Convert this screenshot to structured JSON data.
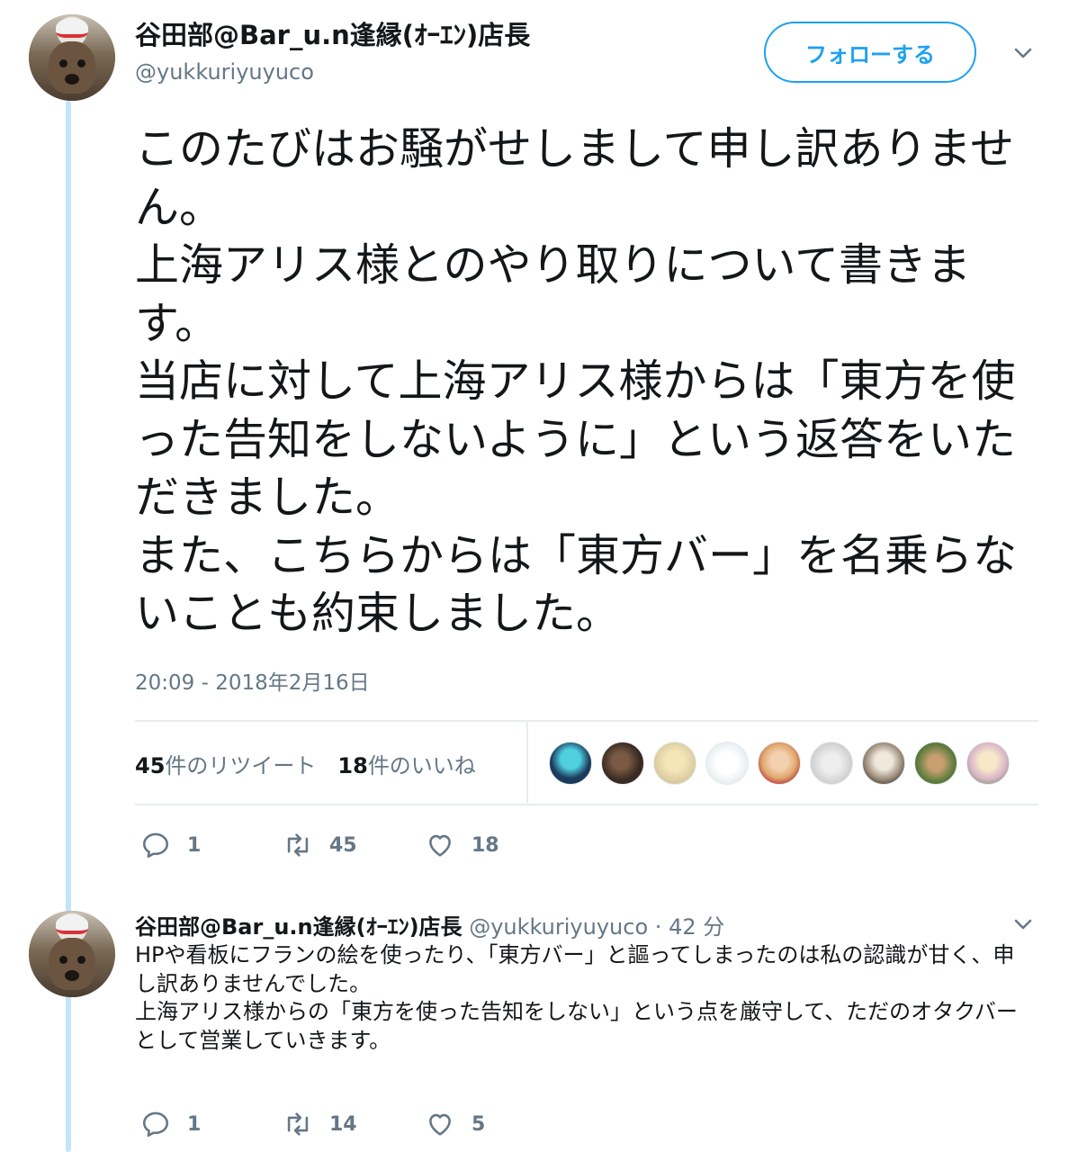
{
  "tweet": {
    "display_name": "谷田部@Bar_u.n逢縁(ｵｰｴﾝ)店長",
    "handle": "@yukkuriyuyuco",
    "follow_label": "フォローする",
    "text": "このたびはお騒がせしまして申し訳ありません。\n上海アリス様とのやり取りについて書きます。\n当店に対して上海アリス様からは「東方を使った告知をしないように」という返答をいただきました。\nまた、こちらからは「東方バー」を名乗らないことも約束しました。",
    "timestamp": "20:09 - 2018年2月16日",
    "retweet_count": "45",
    "retweet_label": "件のリツイート",
    "like_count": "18",
    "like_label": "件のいいね",
    "actions": {
      "reply": "1",
      "retweet": "45",
      "like": "18"
    }
  },
  "reply_tweet": {
    "display_name": "谷田部@Bar_u.n逢縁(ｵｰｴﾝ)店長",
    "handle": "@yukkuriyuyuco",
    "separator": "·",
    "time_ago": "42 分",
    "text": "HPや看板にフランの絵を使ったり、「東方バー」と謳ってしまったのは私の認識が甘く、申し訳ありませんでした。\n上海アリス様からの「東方を使った告知をしない」という点を厳守して、ただのオタクバーとして営業していきます。",
    "actions": {
      "reply": "1",
      "retweet": "14",
      "like": "5"
    }
  },
  "colors": {
    "accent": "#1da1f2",
    "muted": "#657786",
    "thread_line": "#c4e4f8"
  },
  "likers_avatar_colors": [
    "#1b3a5c",
    "#3a2a22",
    "#d9c9a0",
    "#e8eef0",
    "#e0a96d",
    "#cfcfcf",
    "#9a8a78",
    "#5a7a3c",
    "#d8b4c8"
  ]
}
